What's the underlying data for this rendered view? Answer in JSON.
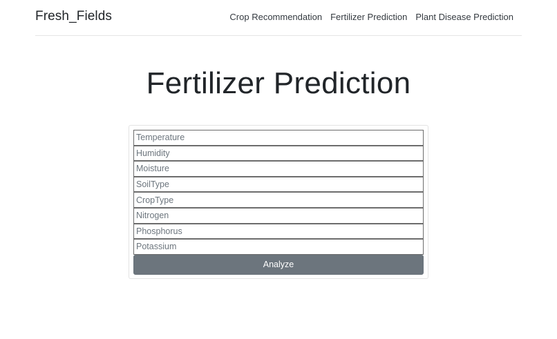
{
  "navbar": {
    "brand": "Fresh_Fields",
    "links": [
      {
        "label": "Crop Recommendation"
      },
      {
        "label": "Fertilizer Prediction"
      },
      {
        "label": "Plant Disease Prediction"
      }
    ]
  },
  "page": {
    "title": "Fertilizer Prediction"
  },
  "form": {
    "fields": [
      {
        "placeholder": "Temperature",
        "value": ""
      },
      {
        "placeholder": "Humidity",
        "value": ""
      },
      {
        "placeholder": "Moisture",
        "value": ""
      },
      {
        "placeholder": "SoilType",
        "value": ""
      },
      {
        "placeholder": "CropType",
        "value": ""
      },
      {
        "placeholder": "Nitrogen",
        "value": ""
      },
      {
        "placeholder": "Phosphorus",
        "value": ""
      },
      {
        "placeholder": "Potassium",
        "value": ""
      }
    ],
    "submit_label": "Analyze"
  },
  "colors": {
    "button_bg": "#6c757d",
    "button_text": "#ffffff",
    "text": "#212529"
  }
}
